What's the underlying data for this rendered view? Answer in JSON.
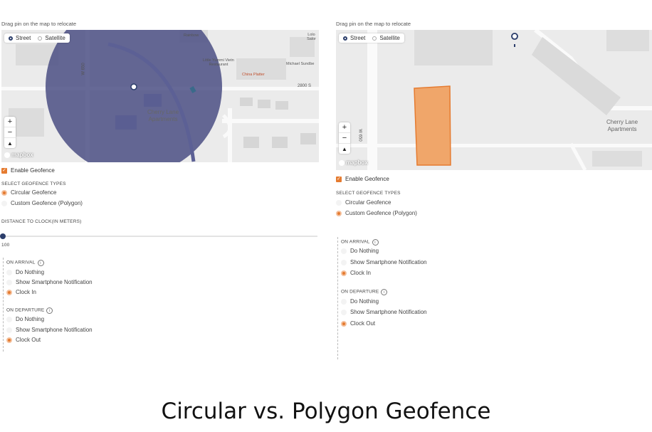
{
  "left": {
    "hint": "Drag pin on the map to relocate",
    "map": {
      "toggle": {
        "street": "Street",
        "satellite": "Satellite",
        "selected": "street"
      },
      "labels": {
        "block": "Cherry Lane\nApartments",
        "street_vert": "W 650",
        "street_2800": "2800 S",
        "poi_1": "Little Yummi Vietn\nRestaurant",
        "poi_2": "China Platter",
        "poi_3": "Michael Sundbe",
        "poi_4": "Rainbow",
        "poi_5": "Lolo Salor"
      },
      "zoom": {
        "in": "+",
        "out": "−",
        "compass": "▲"
      },
      "attribution": "mapbox",
      "geofence_color": "#4b4f84"
    },
    "enable_geofence": "Enable Geofence",
    "types_title": "SELECT GEOFENCE TYPES",
    "types": [
      {
        "label": "Circular Geofence",
        "selected": true
      },
      {
        "label": "Custom Geofence (Polygon)",
        "selected": false
      }
    ],
    "distance_title": "DISTANCE TO CLOCK(IN METERS)",
    "distance_value": "100",
    "on_arrival": {
      "title": "ON ARRIVAL",
      "options": [
        {
          "label": "Do Nothing",
          "selected": false
        },
        {
          "label": "Show Smartphone Notification",
          "selected": false
        },
        {
          "label": "Clock In",
          "selected": true
        }
      ]
    },
    "on_departure": {
      "title": "ON DEPARTURE",
      "options": [
        {
          "label": "Do Nothing",
          "selected": false
        },
        {
          "label": "Show Smartphone Notification",
          "selected": false
        },
        {
          "label": "Clock Out",
          "selected": true
        }
      ]
    }
  },
  "right": {
    "hint": "Drag pin on the map to relocate",
    "map": {
      "toggle": {
        "street": "Street",
        "satellite": "Satellite",
        "selected": "street"
      },
      "labels": {
        "block": "Cherry Lane\nApartments",
        "street_vert": "W 650"
      },
      "zoom": {
        "in": "+",
        "out": "−",
        "compass": "▲"
      },
      "attribution": "mapbox",
      "geofence_color": "#f0a66a"
    },
    "enable_geofence": "Enable Geofence",
    "types_title": "SELECT GEOFENCE TYPES",
    "types": [
      {
        "label": "Circular Geofence",
        "selected": false
      },
      {
        "label": "Custom Geofence (Polygon)",
        "selected": true
      }
    ],
    "on_arrival": {
      "title": "ON ARRIVAL",
      "options": [
        {
          "label": "Do Nothing",
          "selected": false
        },
        {
          "label": "Show Smartphone Notification",
          "selected": false
        },
        {
          "label": "Clock In",
          "selected": true
        }
      ]
    },
    "on_departure": {
      "title": "ON DEPARTURE",
      "options": [
        {
          "label": "Do Nothing",
          "selected": false
        },
        {
          "label": "Show Smartphone Notification",
          "selected": false
        },
        {
          "label": "Clock Out",
          "selected": true
        }
      ]
    }
  },
  "caption": "Circular vs. Polygon Geofence",
  "colors": {
    "accent": "#e57b30",
    "pin": "#2c3e6b"
  },
  "icons": [
    "checkbox-checked-icon",
    "radio-icon",
    "info-icon",
    "map-pin-icon",
    "zoom-in-icon",
    "zoom-out-icon",
    "compass-icon"
  ]
}
